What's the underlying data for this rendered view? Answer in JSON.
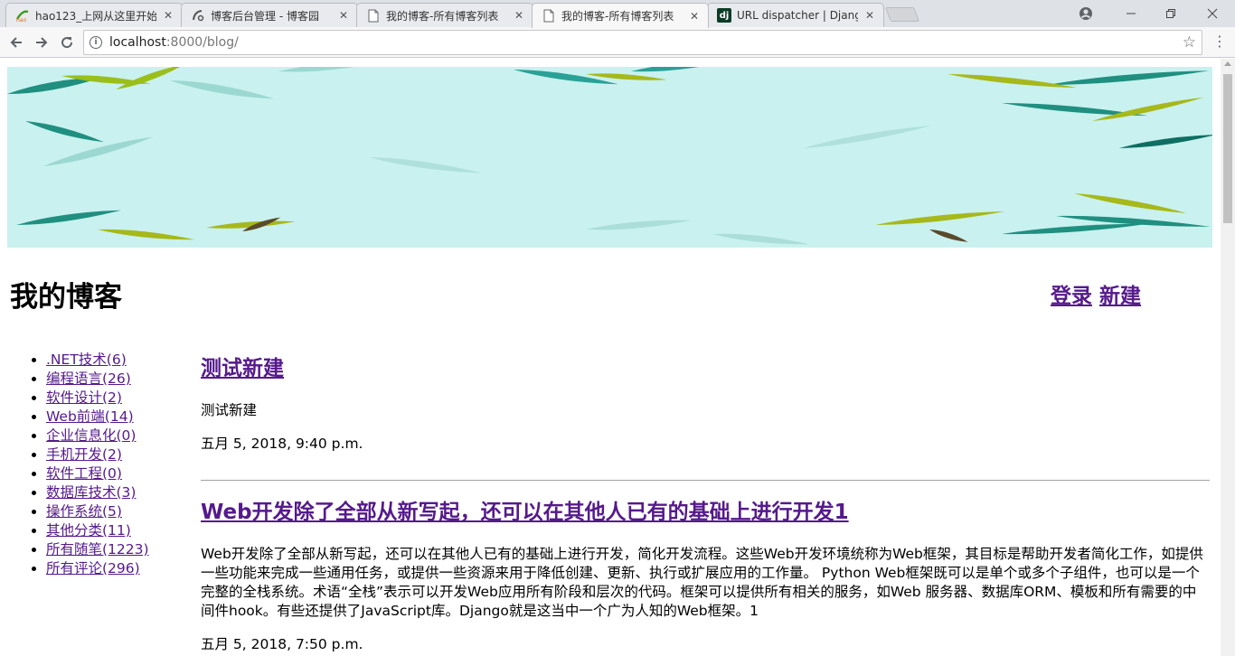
{
  "browser": {
    "tabs": [
      {
        "title": "hao123_上网从这里开始",
        "icon": "hao123-icon",
        "active": false
      },
      {
        "title": "博客后台管理 - 博客园",
        "icon": "cnblogs-icon",
        "active": false
      },
      {
        "title": "我的博客-所有博客列表",
        "icon": "page-icon",
        "active": false
      },
      {
        "title": "我的博客-所有博客列表",
        "icon": "page-icon",
        "active": true
      },
      {
        "title": "URL dispatcher | Django",
        "icon": "django-icon",
        "active": false
      }
    ],
    "url_host": "localhost",
    "url_path": ":8000/blog/"
  },
  "site": {
    "title": "我的博客",
    "login_label": "登录",
    "new_label": "新建"
  },
  "categories": [
    ".NET技术(6)",
    "编程语言(26)",
    "软件设计(2)",
    "Web前端(14)",
    "企业信息化(0)",
    "手机开发(2)",
    "软件工程(0)",
    "数据库技术(3)",
    "操作系统(5)",
    "其他分类(11)",
    "所有随笔(1223)",
    "所有评论(296)"
  ],
  "posts": [
    {
      "title": "测试新建",
      "body": "测试新建",
      "date": "五月 5, 2018, 9:40 p.m."
    },
    {
      "title": "Web开发除了全部从新写起，还可以在其他人已有的基础上进行开发1",
      "body": "Web开发除了全部从新写起，还可以在其他人已有的基础上进行开发，简化开发流程。这些Web开发环境统称为Web框架，其目标是帮助开发者简化工作，如提供一些功能来完成一些通用任务，或提供一些资源来用于降低创建、更新、执行或扩展应用的工作量。 Python Web框架既可以是单个或多个子组件，也可以是一个完整的全栈系统。术语“全栈”表示可以开发Web应用所有阶段和层次的代码。框架可以提供所有相关的服务，如Web 服务器、数据库ORM、模板和所有需要的中间件hook。有些还提供了JavaScript库。Django就是这当中一个广为人知的Web框架。1",
      "date": "五月 5, 2018, 7:50 p.m."
    }
  ],
  "colors": {
    "link_visited": "#551a8b",
    "banner_bg": "#c9f1ef"
  }
}
